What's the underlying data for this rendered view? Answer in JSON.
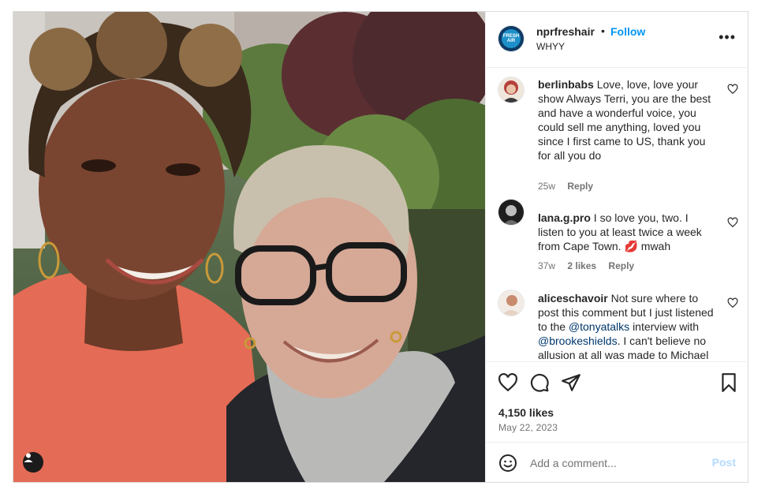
{
  "post": {
    "tag_icon": "person-icon"
  },
  "header": {
    "avatar_text": "FRESH AIR",
    "username": "nprfreshair",
    "separator": "•",
    "follow_label": "Follow",
    "subtitle": "WHYY",
    "more_icon": "ellipsis-icon",
    "more_label": "•••"
  },
  "comments": [
    {
      "username": "berlinbabs",
      "text": "Love, love, love your show Always Terri, you are the best and have a wonderful voice, you could sell me anything, loved you since I first came to US, thank you for all you do",
      "age": "25w",
      "reply_label": "Reply"
    },
    {
      "username": "lana.g.pro",
      "text": "I so love you, two. I listen to you at least twice a week from Cape Town. 💋 mwah",
      "age": "37w",
      "likes": "2 likes",
      "reply_label": "Reply"
    },
    {
      "username": "aliceschavoir",
      "text_1": "Not sure where to post this comment but I just listened to the",
      "mention_1": "@tonyatalks",
      "text_2": "interview with",
      "mention_2": "@brookeshields",
      "text_3": ". I can't believe no allusion at all was made to Michael Jackson's rape"
    }
  ],
  "actions": {
    "like_icon": "heart-icon",
    "comment_icon": "comment-icon",
    "share_icon": "send-icon",
    "save_icon": "bookmark-icon",
    "likes": "4,150 likes",
    "date": "May 22, 2023"
  },
  "add_comment": {
    "emoji_icon": "emoji-icon",
    "placeholder": "Add a comment...",
    "post_label": "Post"
  },
  "colors": {
    "accent": "#0095f6",
    "post_disabled": "#b3dbff",
    "meta": "#737373",
    "mention": "#00376b"
  }
}
